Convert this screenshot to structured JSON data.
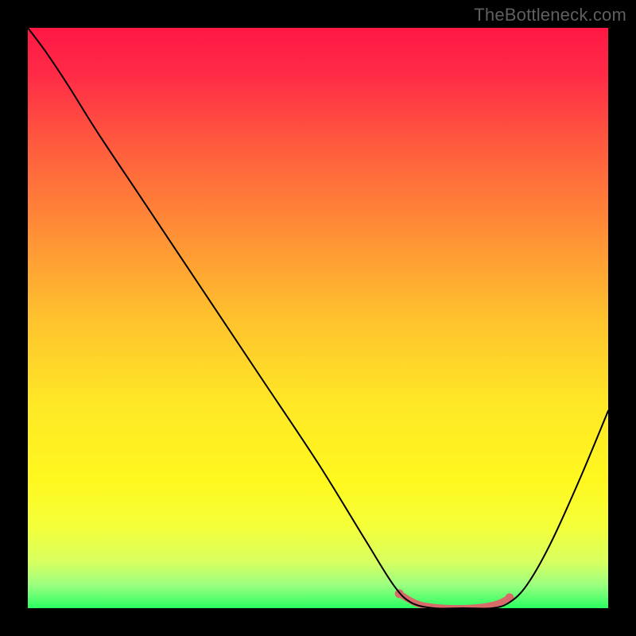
{
  "watermark": "TheBottleneck.com",
  "chart_data": {
    "type": "line",
    "title": "",
    "xlabel": "",
    "ylabel": "",
    "xlim": [
      0,
      100
    ],
    "ylim": [
      0,
      100
    ],
    "background_gradient": {
      "stops": [
        {
          "offset": 0,
          "color": "#ff1744"
        },
        {
          "offset": 8,
          "color": "#ff2b47"
        },
        {
          "offset": 20,
          "color": "#ff5a3e"
        },
        {
          "offset": 35,
          "color": "#ff8e36"
        },
        {
          "offset": 50,
          "color": "#ffc22e"
        },
        {
          "offset": 65,
          "color": "#ffe826"
        },
        {
          "offset": 78,
          "color": "#fff81f"
        },
        {
          "offset": 86,
          "color": "#f4ff3a"
        },
        {
          "offset": 92,
          "color": "#d8ff60"
        },
        {
          "offset": 96,
          "color": "#9cff80"
        },
        {
          "offset": 100,
          "color": "#2aff62"
        }
      ]
    },
    "series": [
      {
        "name": "bottleneck-curve",
        "color": "#000000",
        "width": 2,
        "points": [
          {
            "x": 0,
            "y": 100
          },
          {
            "x": 3,
            "y": 96
          },
          {
            "x": 7,
            "y": 90
          },
          {
            "x": 12,
            "y": 82
          },
          {
            "x": 20,
            "y": 70
          },
          {
            "x": 30,
            "y": 55
          },
          {
            "x": 40,
            "y": 40
          },
          {
            "x": 50,
            "y": 25
          },
          {
            "x": 58,
            "y": 12
          },
          {
            "x": 63,
            "y": 4
          },
          {
            "x": 66,
            "y": 1
          },
          {
            "x": 70,
            "y": 0
          },
          {
            "x": 75,
            "y": 0
          },
          {
            "x": 80,
            "y": 0
          },
          {
            "x": 83,
            "y": 1
          },
          {
            "x": 86,
            "y": 4
          },
          {
            "x": 90,
            "y": 11
          },
          {
            "x": 95,
            "y": 22
          },
          {
            "x": 100,
            "y": 34
          }
        ]
      },
      {
        "name": "highlight-band",
        "color": "#d96a6a",
        "width": 8,
        "points": [
          {
            "x": 64,
            "y": 2.5
          },
          {
            "x": 67,
            "y": 0.8
          },
          {
            "x": 70,
            "y": 0.2
          },
          {
            "x": 74,
            "y": 0
          },
          {
            "x": 78,
            "y": 0.2
          },
          {
            "x": 81,
            "y": 0.8
          },
          {
            "x": 83,
            "y": 1.8
          }
        ]
      }
    ],
    "highlight_dots": [
      {
        "x": 64,
        "y": 2.5
      },
      {
        "x": 83,
        "y": 1.8
      }
    ]
  }
}
